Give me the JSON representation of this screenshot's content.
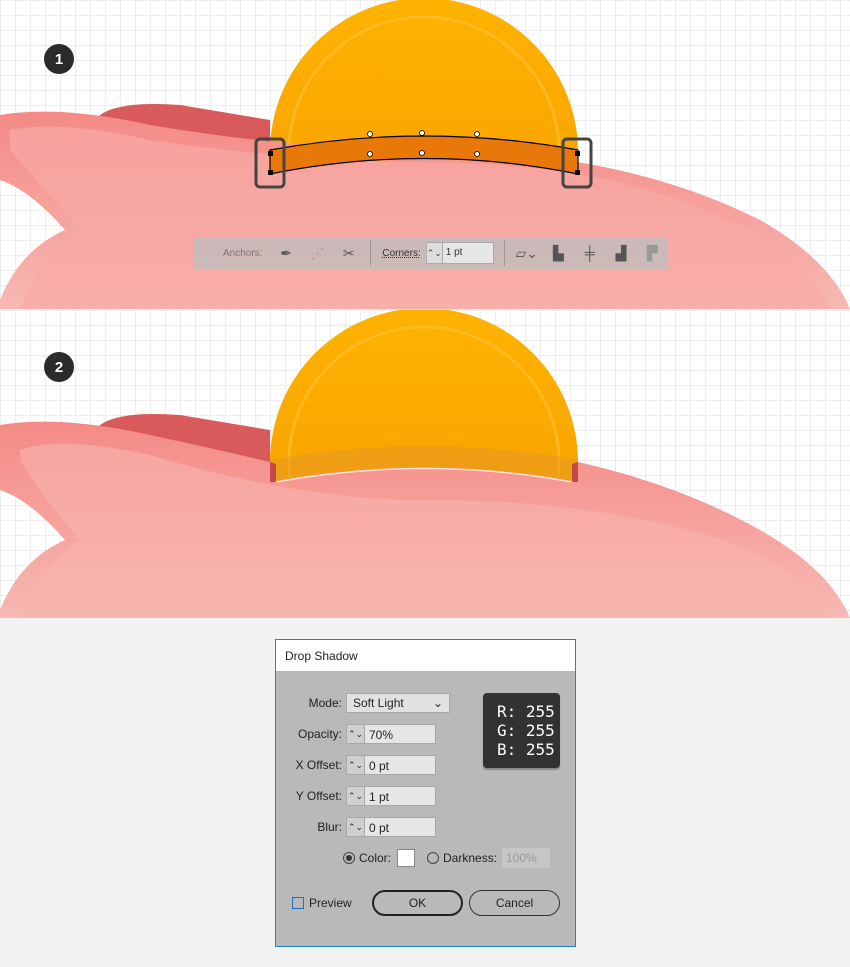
{
  "steps": [
    "1",
    "2"
  ],
  "colors": {
    "coin": "#ffab00",
    "coin_dark": "#f59000",
    "pig": "#f7a6a1",
    "ear": "#d95a5a",
    "slot": "#e8780a",
    "grid": "#dcdcdc"
  },
  "toolbar": {
    "anchors_label": "Anchors:",
    "corners_label": "Corners:",
    "corners_value": "1 pt",
    "icons": [
      "convert-anchor-icon",
      "handles-icon",
      "cut-path-icon",
      "transform-icon",
      "align-left-icon",
      "align-center-icon",
      "align-right-icon",
      "align-top-icon"
    ]
  },
  "dialog": {
    "title": "Drop Shadow",
    "mode_label": "Mode:",
    "mode_value": "Soft Light",
    "opacity_label": "Opacity:",
    "opacity_value": "70%",
    "xoffset_label": "X Offset:",
    "xoffset_value": "0 pt",
    "yoffset_label": "Y Offset:",
    "yoffset_value": "1 pt",
    "blur_label": "Blur:",
    "blur_value": "0 pt",
    "color_label": "Color:",
    "color_selected": true,
    "color_value": "#ffffff",
    "darkness_label": "Darkness:",
    "darkness_value": "100%",
    "preview_label": "Preview",
    "preview_checked": false,
    "ok_label": "OK",
    "cancel_label": "Cancel"
  },
  "rgb": {
    "r": "R: 255",
    "g": "G: 255",
    "b": "B: 255"
  }
}
